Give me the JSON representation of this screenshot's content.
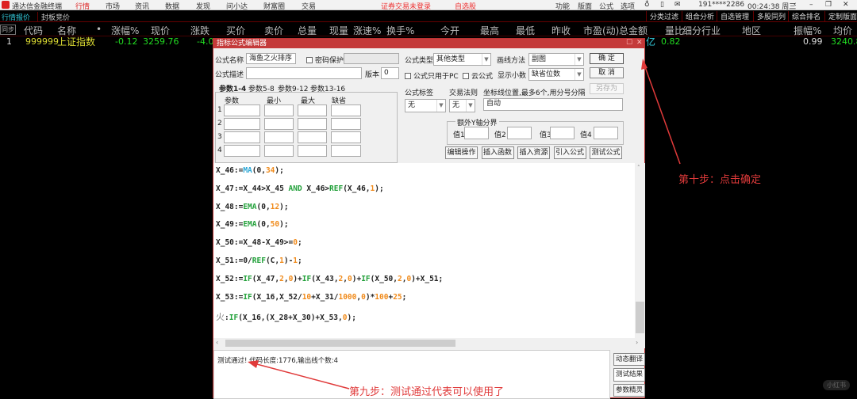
{
  "app": {
    "title": "通达信金融终端",
    "menu": [
      "行情",
      "市场",
      "资讯",
      "数据",
      "发现",
      "问小达",
      "财富圈",
      "交易"
    ],
    "active_menu": "行情",
    "login_status": "证券交易未登录",
    "watchlist": "自选股",
    "right_menu": [
      "功能",
      "版面",
      "公式",
      "选项"
    ],
    "user": "191****2286",
    "clock": "00:24:38 周三",
    "accent": "#c43a3a"
  },
  "tabs": {
    "left": [
      "行情报价",
      "封板竞价"
    ],
    "right": [
      "分类过滤",
      "组合分析",
      "自选管理",
      "多股同列",
      "综合排名",
      "定制版面"
    ]
  },
  "table": {
    "sync": "同步",
    "headers": [
      "代码",
      "名称",
      "•",
      "涨幅%",
      "现价",
      "涨跌",
      "买价",
      "卖价",
      "总量",
      "现量",
      "涨速%",
      "换手%",
      "今开",
      "最高",
      "最低",
      "昨收",
      "市盈(动)",
      "总金额",
      "量比",
      "细分行业",
      "地区",
      "振幅%",
      "均价"
    ],
    "row": {
      "index": "1",
      "code": "999999",
      "name": "上证指数",
      "change_pct": "-0.12",
      "price": "3259.76",
      "change": "-4.0",
      "amount_unit": "亿",
      "vol_ratio": "0.82",
      "amplitude": "0.99",
      "avg_price": "3240.89"
    }
  },
  "dialog": {
    "title": "指标公式编辑器",
    "name_label": "公式名称",
    "name_value": "海鱼之火排序",
    "password_label": "密码保护",
    "desc_label": "公式描述",
    "desc_value": "",
    "version_label": "版本",
    "version_value": "0",
    "type_label": "公式类型",
    "type_value": "其他类型",
    "draw_label": "画线方法",
    "draw_value": "副图",
    "pc_only_label": "公式只用于PC",
    "cloud_label": "云公式",
    "decimal_label": "显示小数",
    "decimal_value": "缺省位数",
    "ok": "确 定",
    "cancel": "取 消",
    "save_as": "另存为",
    "param_tabs": [
      "参数1-4",
      "参数5-8",
      "参数9-12",
      "参数13-16"
    ],
    "param_headers": [
      "参数",
      "最小",
      "最大",
      "缺省"
    ],
    "param_rows": [
      "1",
      "2",
      "3",
      "4"
    ],
    "tag_label": "公式标签",
    "tag_value": "无",
    "rule_label": "交易法则",
    "rule_value": "无",
    "coord_label": "坐标线位置,最多6个,用分号分隔",
    "coord_value": "自动",
    "yaxis_label": "额外Y轴分界",
    "yaxis_values": [
      "值1",
      "值2",
      "值3",
      "值4"
    ],
    "actions": [
      "编辑操作",
      "插入函数",
      "插入资源",
      "引入公式",
      "测试公式"
    ],
    "code_lines": [
      [
        [
          "X_46:=",
          "var"
        ],
        [
          "MA",
          "fb"
        ],
        [
          "(0,",
          "var"
        ],
        [
          "34",
          "num"
        ],
        [
          ");",
          "var"
        ]
      ],
      [
        [
          "X_47:=X_44>X_45 ",
          "var"
        ],
        [
          "AND",
          "fn"
        ],
        [
          " X_46>",
          "var"
        ],
        [
          "REF",
          "fn"
        ],
        [
          "(X_46,",
          "var"
        ],
        [
          "1",
          "num"
        ],
        [
          ");",
          "var"
        ]
      ],
      [
        [
          "X_48:=",
          "var"
        ],
        [
          "EMA",
          "fn"
        ],
        [
          "(0,",
          "var"
        ],
        [
          "12",
          "num"
        ],
        [
          ");",
          "var"
        ]
      ],
      [
        [
          "X_49:=",
          "var"
        ],
        [
          "EMA",
          "fn"
        ],
        [
          "(0,",
          "var"
        ],
        [
          "50",
          "num"
        ],
        [
          ");",
          "var"
        ]
      ],
      [
        [
          "X_50:=X_48-X_49>=",
          "var"
        ],
        [
          "0",
          "num"
        ],
        [
          ";",
          "var"
        ]
      ],
      [
        [
          "X_51:=0/",
          "var"
        ],
        [
          "REF",
          "fn"
        ],
        [
          "(C,",
          "var"
        ],
        [
          "1",
          "num"
        ],
        [
          ")-",
          "var"
        ],
        [
          "1",
          "num"
        ],
        [
          ";",
          "var"
        ]
      ],
      [
        [
          "X_52:=",
          "var"
        ],
        [
          "IF",
          "fn"
        ],
        [
          "(X_47,",
          "var"
        ],
        [
          "2",
          "num"
        ],
        [
          ",",
          "var"
        ],
        [
          "0",
          "num"
        ],
        [
          ")+",
          "var"
        ],
        [
          "IF",
          "fn"
        ],
        [
          "(X_43,",
          "var"
        ],
        [
          "2",
          "num"
        ],
        [
          ",",
          "var"
        ],
        [
          "0",
          "num"
        ],
        [
          ")+",
          "var"
        ],
        [
          "IF",
          "fn"
        ],
        [
          "(X_50,",
          "var"
        ],
        [
          "2",
          "num"
        ],
        [
          ",",
          "var"
        ],
        [
          "0",
          "num"
        ],
        [
          ")+X_51;",
          "var"
        ]
      ],
      [
        [
          "X_53:=",
          "var"
        ],
        [
          "IF",
          "fn"
        ],
        [
          "(X_16,X_52/",
          "var"
        ],
        [
          "10",
          "num"
        ],
        [
          "+X_31/",
          "var"
        ],
        [
          "1000",
          "num"
        ],
        [
          ",",
          "var"
        ],
        [
          "0",
          "num"
        ],
        [
          ")*",
          "var"
        ],
        [
          "100",
          "num"
        ],
        [
          "+",
          "var"
        ],
        [
          "25",
          "num"
        ],
        [
          ";",
          "var"
        ]
      ],
      [
        [
          "火",
          "cn"
        ],
        [
          ":",
          "var"
        ],
        [
          "IF",
          "fn"
        ],
        [
          "(X_16,(X_28+X_30)+X_53,",
          "var"
        ],
        [
          "0",
          "num"
        ],
        [
          ");",
          "var"
        ]
      ]
    ],
    "output": "测试通过! 代码长度:1776,输出线个数:4",
    "side_buttons": [
      "动态翻译",
      "测试结果",
      "参数精灵"
    ]
  },
  "annotations": {
    "step9": "第九步：测试通过代表可以使用了",
    "step10": "第十步：点击确定",
    "color": "#e03a3a"
  },
  "watermark": "小红书"
}
